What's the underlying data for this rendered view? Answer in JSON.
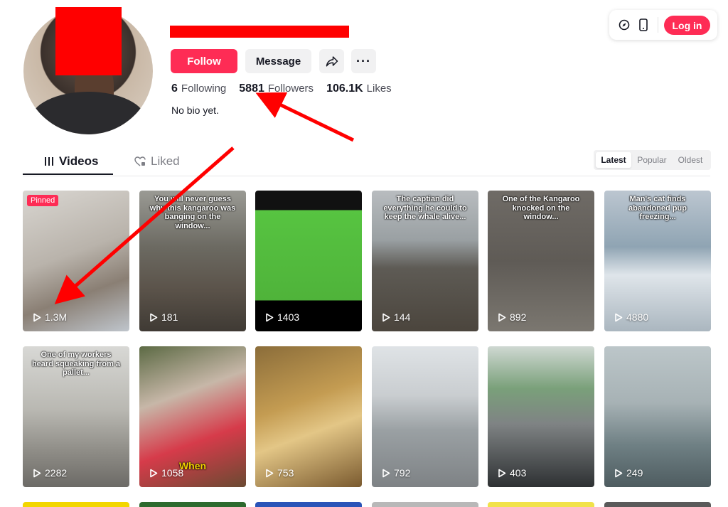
{
  "profile": {
    "follow_label": "Follow",
    "message_label": "Message",
    "more_label": "···",
    "following_count": "6",
    "following_label": "Following",
    "followers_count": "5881",
    "followers_label": "Followers",
    "likes_count": "106.1K",
    "likes_label": "Likes",
    "bio": "No bio yet."
  },
  "topbar": {
    "login_label": "Log in"
  },
  "tabs": [
    {
      "label": "Videos",
      "icon": "grid-icon"
    },
    {
      "label": "Liked",
      "icon": "heart-lock-icon"
    }
  ],
  "sort": [
    "Latest",
    "Popular",
    "Oldest"
  ],
  "videos": [
    {
      "views": "1.3M",
      "badge": "Pinned",
      "caption": ""
    },
    {
      "views": "181",
      "caption": "You will never guess why this kangaroo was banging on the window..."
    },
    {
      "views": "1403",
      "caption": ""
    },
    {
      "views": "144",
      "caption": "The captian did everything he could to keep the whale alive..."
    },
    {
      "views": "892",
      "caption": "One of the Kangaroo knocked on the window..."
    },
    {
      "views": "4880",
      "caption": "Man's cat finds abandoned pup freezing..."
    },
    {
      "views": "2282",
      "caption": "One of my workers heard squeaking from a pallet..."
    },
    {
      "views": "1058",
      "caption": "When"
    },
    {
      "views": "753",
      "caption": ""
    },
    {
      "views": "792",
      "caption": ""
    },
    {
      "views": "403",
      "caption": ""
    },
    {
      "views": "249",
      "caption": ""
    }
  ],
  "colors": {
    "accent": "#fe2c55",
    "annotation": "#ff0000"
  }
}
